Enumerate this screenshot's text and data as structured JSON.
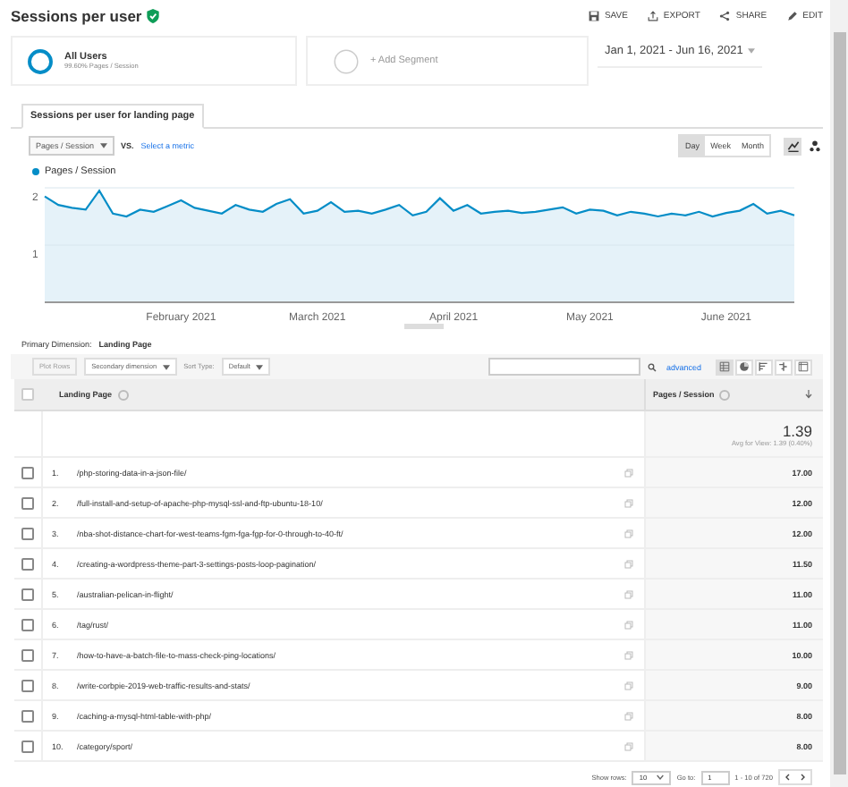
{
  "header": {
    "title": "Sessions per user",
    "actions": [
      {
        "kind": "save",
        "label": "SAVE"
      },
      {
        "kind": "export",
        "label": "EXPORT"
      },
      {
        "kind": "share",
        "label": "SHARE"
      },
      {
        "kind": "edit",
        "label": "EDIT"
      }
    ]
  },
  "segments": [
    {
      "kind": "segment",
      "name": "All Users",
      "detail": "99.60% Pages / Session"
    },
    {
      "kind": "add",
      "name": "+ Add Segment"
    }
  ],
  "date_range": "Jan 1, 2021 - Jun 16, 2021",
  "tab": {
    "label": "Sessions per user for landing page"
  },
  "metric_select": "Pages / Session",
  "vs": "VS.",
  "select_metric": "Select a metric",
  "granularity": [
    {
      "label": "Day",
      "selected": true
    },
    {
      "label": "Week",
      "selected": false
    },
    {
      "label": "Month",
      "selected": false
    }
  ],
  "chart_types": [
    {
      "kind": "line",
      "selected": true
    },
    {
      "kind": "motion",
      "selected": false
    }
  ],
  "chart": {
    "chart_data": {
      "type": "area",
      "categories": [
        null,
        null,
        null,
        null,
        null,
        null,
        null,
        null,
        null,
        null,
        "February 2021",
        null,
        null,
        null,
        null,
        null,
        null,
        null,
        null,
        null,
        "March 2021",
        null,
        null,
        null,
        null,
        null,
        null,
        null,
        null,
        null,
        "April 2021",
        null,
        null,
        null,
        null,
        null,
        null,
        null,
        null,
        null,
        "May 2021",
        null,
        null,
        null,
        null,
        null,
        null,
        null,
        null,
        null,
        "June 2021",
        null,
        null,
        null,
        null,
        null
      ],
      "series": [
        {
          "name": "Pages / Session",
          "color": "#058dc7",
          "values": [
            1.85,
            1.7,
            1.65,
            1.62,
            1.95,
            1.55,
            1.5,
            1.62,
            1.58,
            1.68,
            1.78,
            1.65,
            1.6,
            1.55,
            1.7,
            1.62,
            1.58,
            1.72,
            1.8,
            1.55,
            1.6,
            1.75,
            1.58,
            1.6,
            1.55,
            1.62,
            1.7,
            1.52,
            1.58,
            1.82,
            1.6,
            1.7,
            1.55,
            1.58,
            1.6,
            1.56,
            1.58,
            1.62,
            1.66,
            1.55,
            1.62,
            1.6,
            1.52,
            1.58,
            1.55,
            1.5,
            1.55,
            1.52,
            1.58,
            1.5,
            1.56,
            1.6,
            1.72,
            1.55,
            1.6,
            1.52
          ]
        }
      ],
      "ylim": [
        0,
        2
      ],
      "yticks": [
        1,
        2
      ]
    }
  },
  "primary_dimension": {
    "label": "Primary Dimension:",
    "value": "Landing Page"
  },
  "toolbar": {
    "plot_rows": {
      "label": "Plot Rows",
      "disabled": true
    },
    "secondary": "Secondary dimension",
    "sort_label": "Sort Type:",
    "sort_value": "Default",
    "advanced": "advanced",
    "views": [
      {
        "kind": "table",
        "selected": true
      },
      {
        "kind": "pie",
        "selected": false
      },
      {
        "kind": "performance",
        "selected": false
      },
      {
        "kind": "comparison",
        "selected": false
      },
      {
        "kind": "pivot",
        "selected": false
      }
    ]
  },
  "table": {
    "select_all_checked": false,
    "columns": [
      "Landing Page",
      "Pages / Session"
    ],
    "total": {
      "value": "1.39",
      "note": "Avg for View: 1.39 (0.40%)"
    },
    "rows": [
      {
        "index": "1.",
        "page": "/php-storing-data-in-a-json-file/",
        "value": "17.00",
        "checked": false
      },
      {
        "index": "2.",
        "page": "/full-install-and-setup-of-apache-php-mysql-ssl-and-ftp-ubuntu-18-10/",
        "value": "12.00",
        "checked": false
      },
      {
        "index": "3.",
        "page": "/nba-shot-distance-chart-for-west-teams-fgm-fga-fgp-for-0-through-to-40-ft/",
        "value": "12.00",
        "checked": false
      },
      {
        "index": "4.",
        "page": "/creating-a-wordpress-theme-part-3-settings-posts-loop-pagination/",
        "value": "11.50",
        "checked": false
      },
      {
        "index": "5.",
        "page": "/australian-pelican-in-flight/",
        "value": "11.00",
        "checked": false
      },
      {
        "index": "6.",
        "page": "/tag/rust/",
        "value": "11.00",
        "checked": false
      },
      {
        "index": "7.",
        "page": "/how-to-have-a-batch-file-to-mass-check-ping-locations/",
        "value": "10.00",
        "checked": false
      },
      {
        "index": "8.",
        "page": "/write-corbpie-2019-web-traffic-results-and-stats/",
        "value": "9.00",
        "checked": false
      },
      {
        "index": "9.",
        "page": "/caching-a-mysql-html-table-with-php/",
        "value": "8.00",
        "checked": false
      },
      {
        "index": "10.",
        "page": "/category/sport/",
        "value": "8.00",
        "checked": false
      }
    ]
  },
  "pagination": {
    "show_rows_label": "Show rows:",
    "show_rows": "10",
    "goto_label": "Go to:",
    "goto": "1",
    "range": "1 - 10 of 720"
  }
}
